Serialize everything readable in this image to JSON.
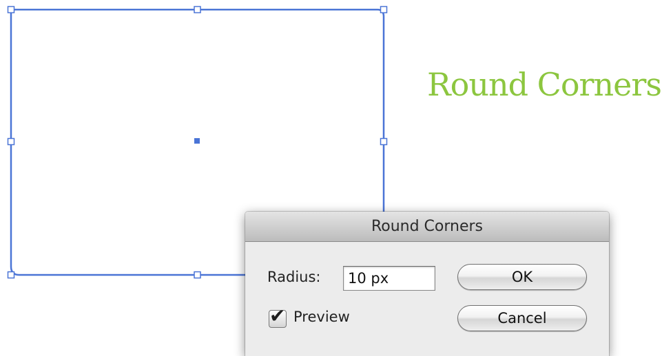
{
  "heading": {
    "text": "Round Corners",
    "color": "#8cc63f"
  },
  "artboard": {
    "selection_color": "#4a74d6"
  },
  "dialog": {
    "title": "Round Corners",
    "radius_label": "Radius:",
    "radius_value": "10 px",
    "preview_label": "Preview",
    "preview_checked": true,
    "ok_label": "OK",
    "cancel_label": "Cancel"
  },
  "icons": {
    "preview_check": "checkmark-icon"
  }
}
